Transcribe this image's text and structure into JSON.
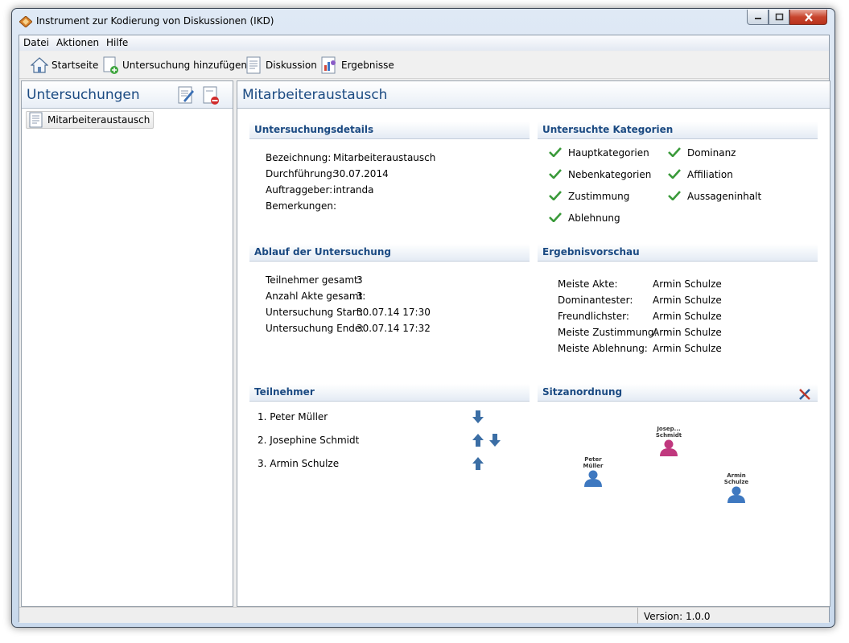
{
  "window": {
    "title": "Instrument zur Kodierung von Diskussionen (IKD)"
  },
  "menu": [
    "Datei",
    "Aktionen",
    "Hilfe"
  ],
  "toolbar": {
    "home": "Startseite",
    "add": "Untersuchung hinzufügen",
    "discussion": "Diskussion",
    "results": "Ergebnisse"
  },
  "left": {
    "title": "Untersuchungen",
    "items": [
      "Mitarbeiteraustausch"
    ]
  },
  "right": {
    "title": "Mitarbeiteraustausch",
    "details": {
      "heading": "Untersuchungsdetails",
      "rows": [
        {
          "label": "Bezeichnung:",
          "value": "Mitarbeiteraustausch"
        },
        {
          "label": "Durchführung:",
          "value": "30.07.2014"
        },
        {
          "label": "Auftraggeber:",
          "value": "intranda"
        },
        {
          "label": "Bemerkungen:",
          "value": ""
        }
      ]
    },
    "categories": {
      "heading": "Untersuchte Kategorien",
      "col1": [
        "Hauptkategorien",
        "Nebenkategorien",
        "Zustimmung",
        "Ablehnung"
      ],
      "col2": [
        "Dominanz",
        "Affiliation",
        "Aussageninhalt"
      ]
    },
    "progress": {
      "heading": "Ablauf der Untersuchung",
      "rows": [
        {
          "label": "Teilnehmer gesamt:",
          "value": "3"
        },
        {
          "label": "Anzahl Akte gesamt:",
          "value": "3"
        },
        {
          "label": "Untersuchung Start:",
          "value": "30.07.14 17:30"
        },
        {
          "label": "Untersuchung Ende:",
          "value": "30.07.14 17:32"
        }
      ]
    },
    "preview": {
      "heading": "Ergebnisvorschau",
      "rows": [
        {
          "label": "Meiste Akte:",
          "value": "Armin Schulze"
        },
        {
          "label": "Dominantester:",
          "value": "Armin Schulze"
        },
        {
          "label": "Freundlichster:",
          "value": "Armin Schulze"
        },
        {
          "label": "Meiste Zustimmung:",
          "value": "Armin Schulze"
        },
        {
          "label": "Meiste Ablehnung:",
          "value": "Armin Schulze"
        }
      ]
    },
    "participants": {
      "heading": "Teilnehmer",
      "list": [
        "1.  Peter Müller",
        "2.  Josephine Schmidt",
        "3.  Armin Schulze"
      ]
    },
    "seating": {
      "heading": "Sitzanordnung",
      "seats": [
        {
          "line1": "Josep...",
          "line2": "Schmidt",
          "color": "#c0387e"
        },
        {
          "line1": "Peter",
          "line2": "Müller",
          "color": "#3e78c0"
        },
        {
          "line1": "Armin",
          "line2": "Schulze",
          "color": "#3e78c0"
        }
      ]
    }
  },
  "status": {
    "version": "Version: 1.0.0"
  },
  "colors": {
    "heading": "#1b4a82",
    "check": "#3a9a3a",
    "arrow": "#3b6ea5"
  }
}
